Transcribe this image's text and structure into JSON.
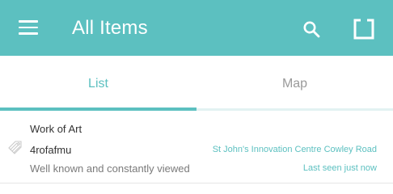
{
  "colors": {
    "accent": "#5cc0c0",
    "inactive_tab": "#9a9a9a",
    "text": "#333333",
    "muted": "#7a7a7a"
  },
  "app_bar": {
    "title": "All Items",
    "menu_icon": "hamburger-menu-icon",
    "search_icon": "search-icon",
    "scan_icon": "scan-frame-icon"
  },
  "tabs": [
    {
      "label": "List",
      "selected": true
    },
    {
      "label": "Map",
      "selected": false
    }
  ],
  "items": [
    {
      "icon": "tag-icon",
      "name": "Work of Art",
      "code": "4rofafmu",
      "description": "Well known and constantly viewed",
      "location": "St John's Innovation Centre Cowley Road",
      "last_seen": "Last seen just now"
    }
  ]
}
